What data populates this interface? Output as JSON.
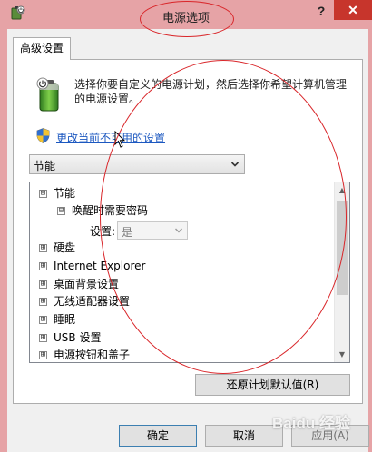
{
  "window": {
    "title": "电源选项",
    "help_label": "?",
    "close_label": "✕"
  },
  "tabs": [
    {
      "label": "高级设置",
      "active": true
    }
  ],
  "description": "选择你要自定义的电源计划，然后选择你希望计算机管理的电源设置。",
  "change_link": "更改当前不可用的设置",
  "plan_select": {
    "value": "节能"
  },
  "tree": {
    "items": [
      {
        "label": "节能",
        "toggle": "⊟",
        "level": 0
      },
      {
        "label": "唤醒时需要密码",
        "toggle": "⊟",
        "level": 1
      },
      {
        "label": "硬盘",
        "toggle": "⊞",
        "level": 0
      },
      {
        "label": "Internet Explorer",
        "toggle": "⊞",
        "level": 0
      },
      {
        "label": "桌面背景设置",
        "toggle": "⊞",
        "level": 0
      },
      {
        "label": "无线适配器设置",
        "toggle": "⊞",
        "level": 0
      },
      {
        "label": "睡眠",
        "toggle": "⊞",
        "level": 0
      },
      {
        "label": "USB 设置",
        "toggle": "⊞",
        "level": 0
      },
      {
        "label": "电源按钮和盖子",
        "toggle": "⊞",
        "level": 0
      }
    ],
    "setting_label": "设置:",
    "setting_value": "是"
  },
  "buttons": {
    "restore": "还原计划默认值(R)",
    "ok": "确定",
    "cancel": "取消",
    "apply": "应用(A)"
  },
  "watermark": "Baidu 经验",
  "colors": {
    "title_bar": "#e6a3a6",
    "close": "#c7352c",
    "link": "#1c58c0",
    "annotation": "#d9262a"
  }
}
